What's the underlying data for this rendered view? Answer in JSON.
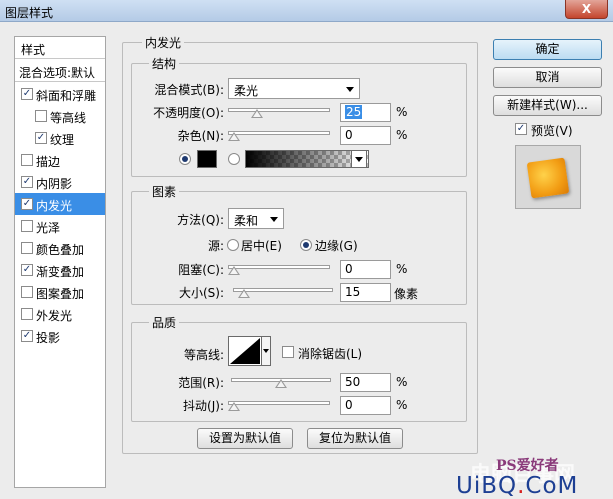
{
  "window": {
    "title": "图层样式",
    "close_label": "X"
  },
  "left_panel": {
    "header": "样式",
    "blend_options": "混合选项:默认",
    "items": [
      {
        "label": "斜面和浮雕",
        "checked": true
      },
      {
        "label": "等高线",
        "checked": false
      },
      {
        "label": "纹理",
        "checked": true
      },
      {
        "label": "描边",
        "checked": false
      },
      {
        "label": "内阴影",
        "checked": true
      },
      {
        "label": "内发光",
        "checked": true,
        "selected": true
      },
      {
        "label": "光泽",
        "checked": false
      },
      {
        "label": "颜色叠加",
        "checked": false
      },
      {
        "label": "渐变叠加",
        "checked": true
      },
      {
        "label": "图案叠加",
        "checked": false
      },
      {
        "label": "外发光",
        "checked": false
      },
      {
        "label": "投影",
        "checked": true
      }
    ]
  },
  "main": {
    "title": "内发光",
    "structure": {
      "title": "结构",
      "blend_mode_label": "混合模式(B):",
      "blend_mode_value": "柔光",
      "opacity_label": "不透明度(O):",
      "opacity_value": "25",
      "opacity_unit": "%",
      "noise_label": "杂色(N):",
      "noise_value": "0",
      "noise_unit": "%",
      "color_mode": "solid",
      "color": "#000000"
    },
    "elements": {
      "title": "图素",
      "method_label": "方法(Q):",
      "method_value": "柔和",
      "source_label": "源:",
      "source_center": "居中(E)",
      "source_edge": "边缘(G)",
      "source_selected": "edge",
      "choke_label": "阻塞(C):",
      "choke_value": "0",
      "choke_unit": "%",
      "size_label": "大小(S):",
      "size_value": "15",
      "size_unit": "像素"
    },
    "quality": {
      "title": "品质",
      "contour_label": "等高线:",
      "antialias_label": "消除锯齿(L)",
      "antialias_checked": false,
      "range_label": "范围(R):",
      "range_value": "50",
      "range_unit": "%",
      "jitter_label": "抖动(J):",
      "jitter_value": "0",
      "jitter_unit": "%"
    },
    "make_default": "设置为默认值",
    "reset_default": "复位为默认值"
  },
  "right": {
    "ok": "确定",
    "cancel": "取消",
    "new_style": "新建样式(W)...",
    "preview_label": "预览(V)",
    "preview_checked": true
  },
  "watermark": {
    "ps": "PS爱好者",
    "faint": "电脑百事网",
    "bottom_prefix": "UiBQ",
    "bottom_mid": ".",
    "bottom_suffix": "CoM"
  },
  "colors": {
    "selection": "#3a8ee6",
    "preview_orange": "#f29c13",
    "primary_border": "#3c7fb1"
  }
}
